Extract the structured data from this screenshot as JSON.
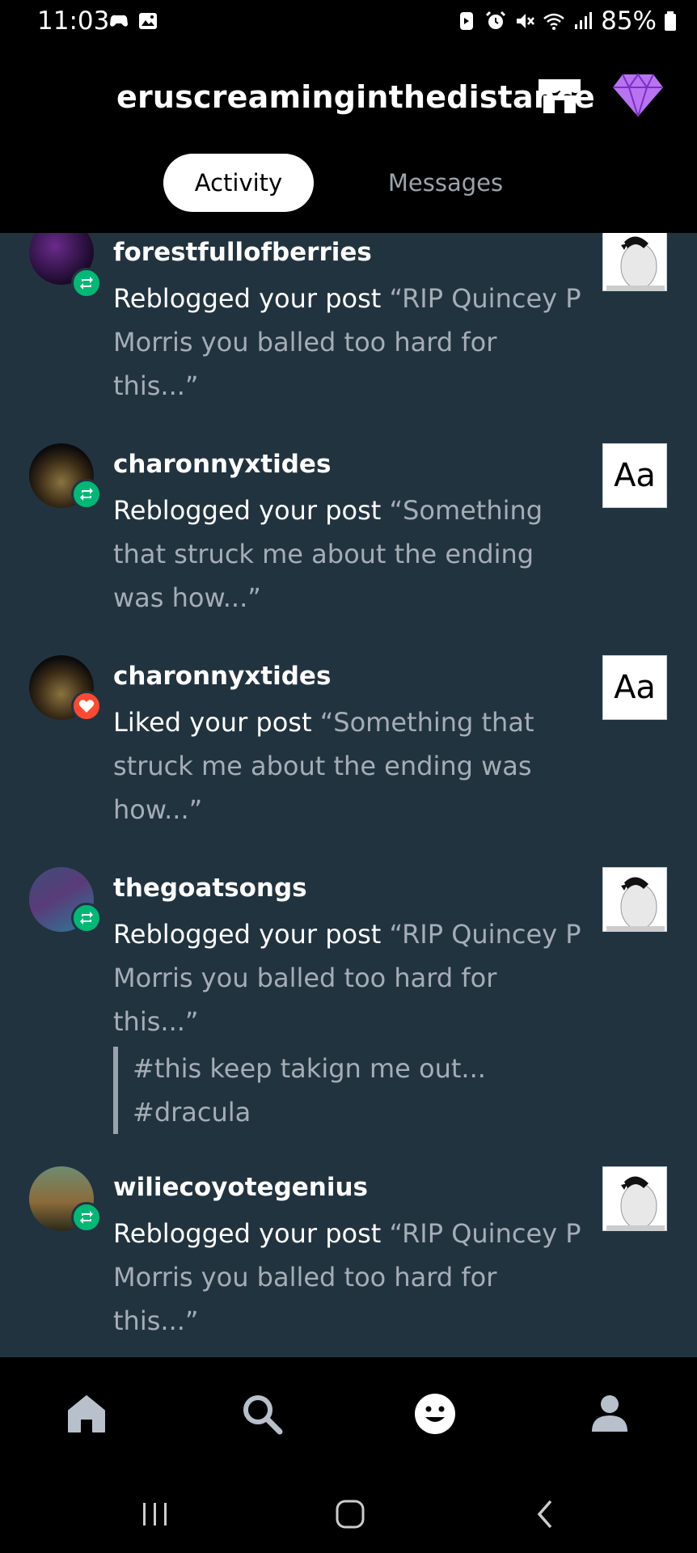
{
  "status_bar": {
    "time": "11:03",
    "battery": "85%"
  },
  "header": {
    "blog_name": "eruscreaminginthedistance"
  },
  "tabs": {
    "activity": "Activity",
    "messages": "Messages"
  },
  "colors": {
    "feed_bg": "#223340",
    "reblog_badge": "#02b875",
    "like_badge": "#ff4930",
    "gem": "#b873f2"
  },
  "activity": [
    {
      "username": "forestfullofberries",
      "action": "Reblogged your post ",
      "quote": "“RIP Quincey P Morris you balled too hard for this...”",
      "badge": "reblog-icon",
      "thumb": "penguin-image"
    },
    {
      "username": "charonnyxtides",
      "action": "Reblogged your post ",
      "quote": "“Something that struck me about the ending was how...”",
      "badge": "reblog-icon",
      "thumb": "Aa"
    },
    {
      "username": "charonnyxtides",
      "action": "Liked your post ",
      "quote": "“Something that struck me about the ending was how...”",
      "badge": "heart-icon",
      "thumb": "Aa"
    },
    {
      "username": "thegoatsongs",
      "action": "Reblogged your post ",
      "quote": "“RIP Quincey P Morris you balled too hard for this...”",
      "badge": "reblog-icon",
      "thumb": "penguin-image",
      "tags": [
        "#this keep takign me out...",
        "#dracula"
      ]
    },
    {
      "username": "wiliecoyotegenius",
      "action": "Reblogged your post ",
      "quote": "“RIP Quincey P Morris you balled too hard for this...”",
      "badge": "reblog-icon",
      "thumb": "penguin-image"
    }
  ],
  "bottom_nav": [
    "home-icon",
    "search-icon",
    "activity-icon",
    "account-icon"
  ],
  "system_nav": [
    "recent-apps-icon",
    "home-button-icon",
    "back-icon"
  ]
}
